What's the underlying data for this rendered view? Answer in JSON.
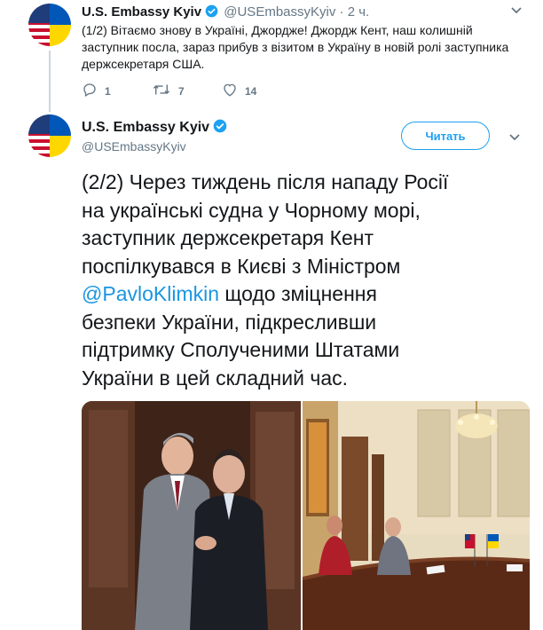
{
  "tweet1": {
    "author_name": "U.S. Embassy Kyiv",
    "handle": "@USEmbassyKyiv",
    "separator": "·",
    "time": "2 ч.",
    "text": "(1/2) Вітаємо знову в Україні, Джордже! Джордж Кент, наш колишній заступник посла, зараз прибув з візитом в Україну в новій ролі заступника держсекретаря США.",
    "reply_count": "1",
    "retweet_count": "7",
    "like_count": "14",
    "icons": [
      "reply-icon",
      "retweet-icon",
      "heart-icon",
      "chevron-down-icon",
      "verified-badge-icon"
    ]
  },
  "tweet2": {
    "author_name": "U.S. Embassy Kyiv",
    "handle": "@USEmbassyKyiv",
    "follow_label": "Читать",
    "text_lines": [
      "(2/2) Через тиждень після нападу Росії",
      "на українські судна у Чорному морі,",
      "заступник держсекретаря Кент",
      "поспілкувався в Києві з Міністром",
      "щодо зміцнення",
      "безпеки України, підкресливши",
      "підтримку Сполученими Штатами",
      "України в цей складний час."
    ],
    "mention": "@PavloKlimkin",
    "photos": [
      "handshake-photo",
      "meeting-photo"
    ]
  },
  "colors": {
    "accent": "#1da1f2",
    "link": "#1b95e0",
    "secondary_text": "#657786",
    "thread_line": "#ccd6dd",
    "flag_blue": "#0057b7",
    "flag_yellow": "#ffd700"
  }
}
